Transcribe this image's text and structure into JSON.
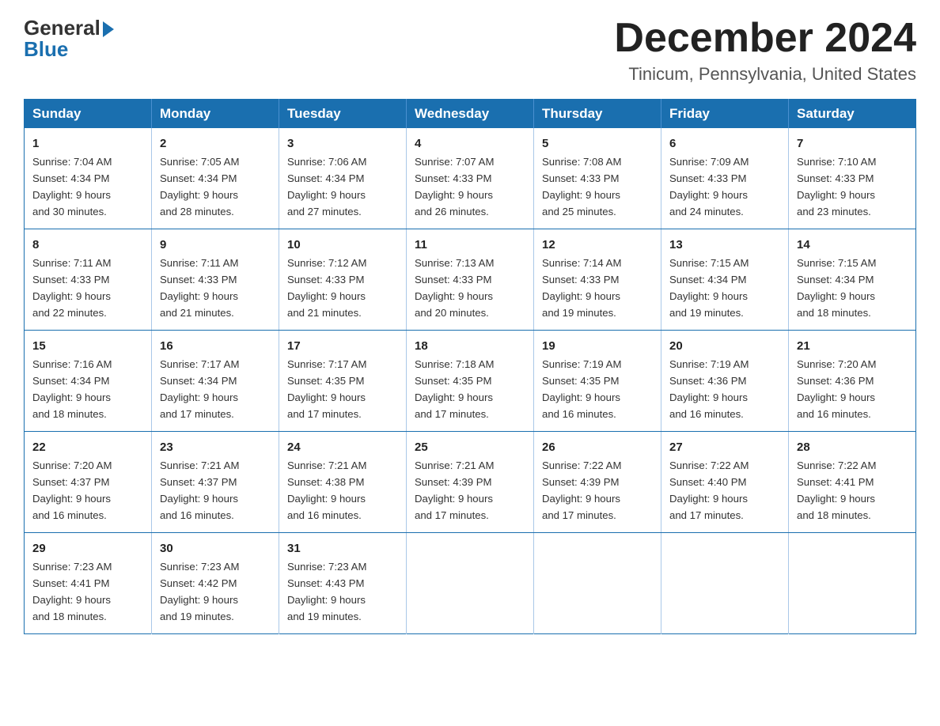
{
  "header": {
    "logo_line1": "General",
    "logo_line2": "Blue",
    "month_title": "December 2024",
    "location": "Tinicum, Pennsylvania, United States"
  },
  "weekdays": [
    "Sunday",
    "Monday",
    "Tuesday",
    "Wednesday",
    "Thursday",
    "Friday",
    "Saturday"
  ],
  "weeks": [
    [
      {
        "day": "1",
        "sunrise": "7:04 AM",
        "sunset": "4:34 PM",
        "daylight": "9 hours and 30 minutes."
      },
      {
        "day": "2",
        "sunrise": "7:05 AM",
        "sunset": "4:34 PM",
        "daylight": "9 hours and 28 minutes."
      },
      {
        "day": "3",
        "sunrise": "7:06 AM",
        "sunset": "4:34 PM",
        "daylight": "9 hours and 27 minutes."
      },
      {
        "day": "4",
        "sunrise": "7:07 AM",
        "sunset": "4:33 PM",
        "daylight": "9 hours and 26 minutes."
      },
      {
        "day": "5",
        "sunrise": "7:08 AM",
        "sunset": "4:33 PM",
        "daylight": "9 hours and 25 minutes."
      },
      {
        "day": "6",
        "sunrise": "7:09 AM",
        "sunset": "4:33 PM",
        "daylight": "9 hours and 24 minutes."
      },
      {
        "day": "7",
        "sunrise": "7:10 AM",
        "sunset": "4:33 PM",
        "daylight": "9 hours and 23 minutes."
      }
    ],
    [
      {
        "day": "8",
        "sunrise": "7:11 AM",
        "sunset": "4:33 PM",
        "daylight": "9 hours and 22 minutes."
      },
      {
        "day": "9",
        "sunrise": "7:11 AM",
        "sunset": "4:33 PM",
        "daylight": "9 hours and 21 minutes."
      },
      {
        "day": "10",
        "sunrise": "7:12 AM",
        "sunset": "4:33 PM",
        "daylight": "9 hours and 21 minutes."
      },
      {
        "day": "11",
        "sunrise": "7:13 AM",
        "sunset": "4:33 PM",
        "daylight": "9 hours and 20 minutes."
      },
      {
        "day": "12",
        "sunrise": "7:14 AM",
        "sunset": "4:33 PM",
        "daylight": "9 hours and 19 minutes."
      },
      {
        "day": "13",
        "sunrise": "7:15 AM",
        "sunset": "4:34 PM",
        "daylight": "9 hours and 19 minutes."
      },
      {
        "day": "14",
        "sunrise": "7:15 AM",
        "sunset": "4:34 PM",
        "daylight": "9 hours and 18 minutes."
      }
    ],
    [
      {
        "day": "15",
        "sunrise": "7:16 AM",
        "sunset": "4:34 PM",
        "daylight": "9 hours and 18 minutes."
      },
      {
        "day": "16",
        "sunrise": "7:17 AM",
        "sunset": "4:34 PM",
        "daylight": "9 hours and 17 minutes."
      },
      {
        "day": "17",
        "sunrise": "7:17 AM",
        "sunset": "4:35 PM",
        "daylight": "9 hours and 17 minutes."
      },
      {
        "day": "18",
        "sunrise": "7:18 AM",
        "sunset": "4:35 PM",
        "daylight": "9 hours and 17 minutes."
      },
      {
        "day": "19",
        "sunrise": "7:19 AM",
        "sunset": "4:35 PM",
        "daylight": "9 hours and 16 minutes."
      },
      {
        "day": "20",
        "sunrise": "7:19 AM",
        "sunset": "4:36 PM",
        "daylight": "9 hours and 16 minutes."
      },
      {
        "day": "21",
        "sunrise": "7:20 AM",
        "sunset": "4:36 PM",
        "daylight": "9 hours and 16 minutes."
      }
    ],
    [
      {
        "day": "22",
        "sunrise": "7:20 AM",
        "sunset": "4:37 PM",
        "daylight": "9 hours and 16 minutes."
      },
      {
        "day": "23",
        "sunrise": "7:21 AM",
        "sunset": "4:37 PM",
        "daylight": "9 hours and 16 minutes."
      },
      {
        "day": "24",
        "sunrise": "7:21 AM",
        "sunset": "4:38 PM",
        "daylight": "9 hours and 16 minutes."
      },
      {
        "day": "25",
        "sunrise": "7:21 AM",
        "sunset": "4:39 PM",
        "daylight": "9 hours and 17 minutes."
      },
      {
        "day": "26",
        "sunrise": "7:22 AM",
        "sunset": "4:39 PM",
        "daylight": "9 hours and 17 minutes."
      },
      {
        "day": "27",
        "sunrise": "7:22 AM",
        "sunset": "4:40 PM",
        "daylight": "9 hours and 17 minutes."
      },
      {
        "day": "28",
        "sunrise": "7:22 AM",
        "sunset": "4:41 PM",
        "daylight": "9 hours and 18 minutes."
      }
    ],
    [
      {
        "day": "29",
        "sunrise": "7:23 AM",
        "sunset": "4:41 PM",
        "daylight": "9 hours and 18 minutes."
      },
      {
        "day": "30",
        "sunrise": "7:23 AM",
        "sunset": "4:42 PM",
        "daylight": "9 hours and 19 minutes."
      },
      {
        "day": "31",
        "sunrise": "7:23 AM",
        "sunset": "4:43 PM",
        "daylight": "9 hours and 19 minutes."
      },
      null,
      null,
      null,
      null
    ]
  ],
  "labels": {
    "sunrise": "Sunrise:",
    "sunset": "Sunset:",
    "daylight": "Daylight:"
  }
}
